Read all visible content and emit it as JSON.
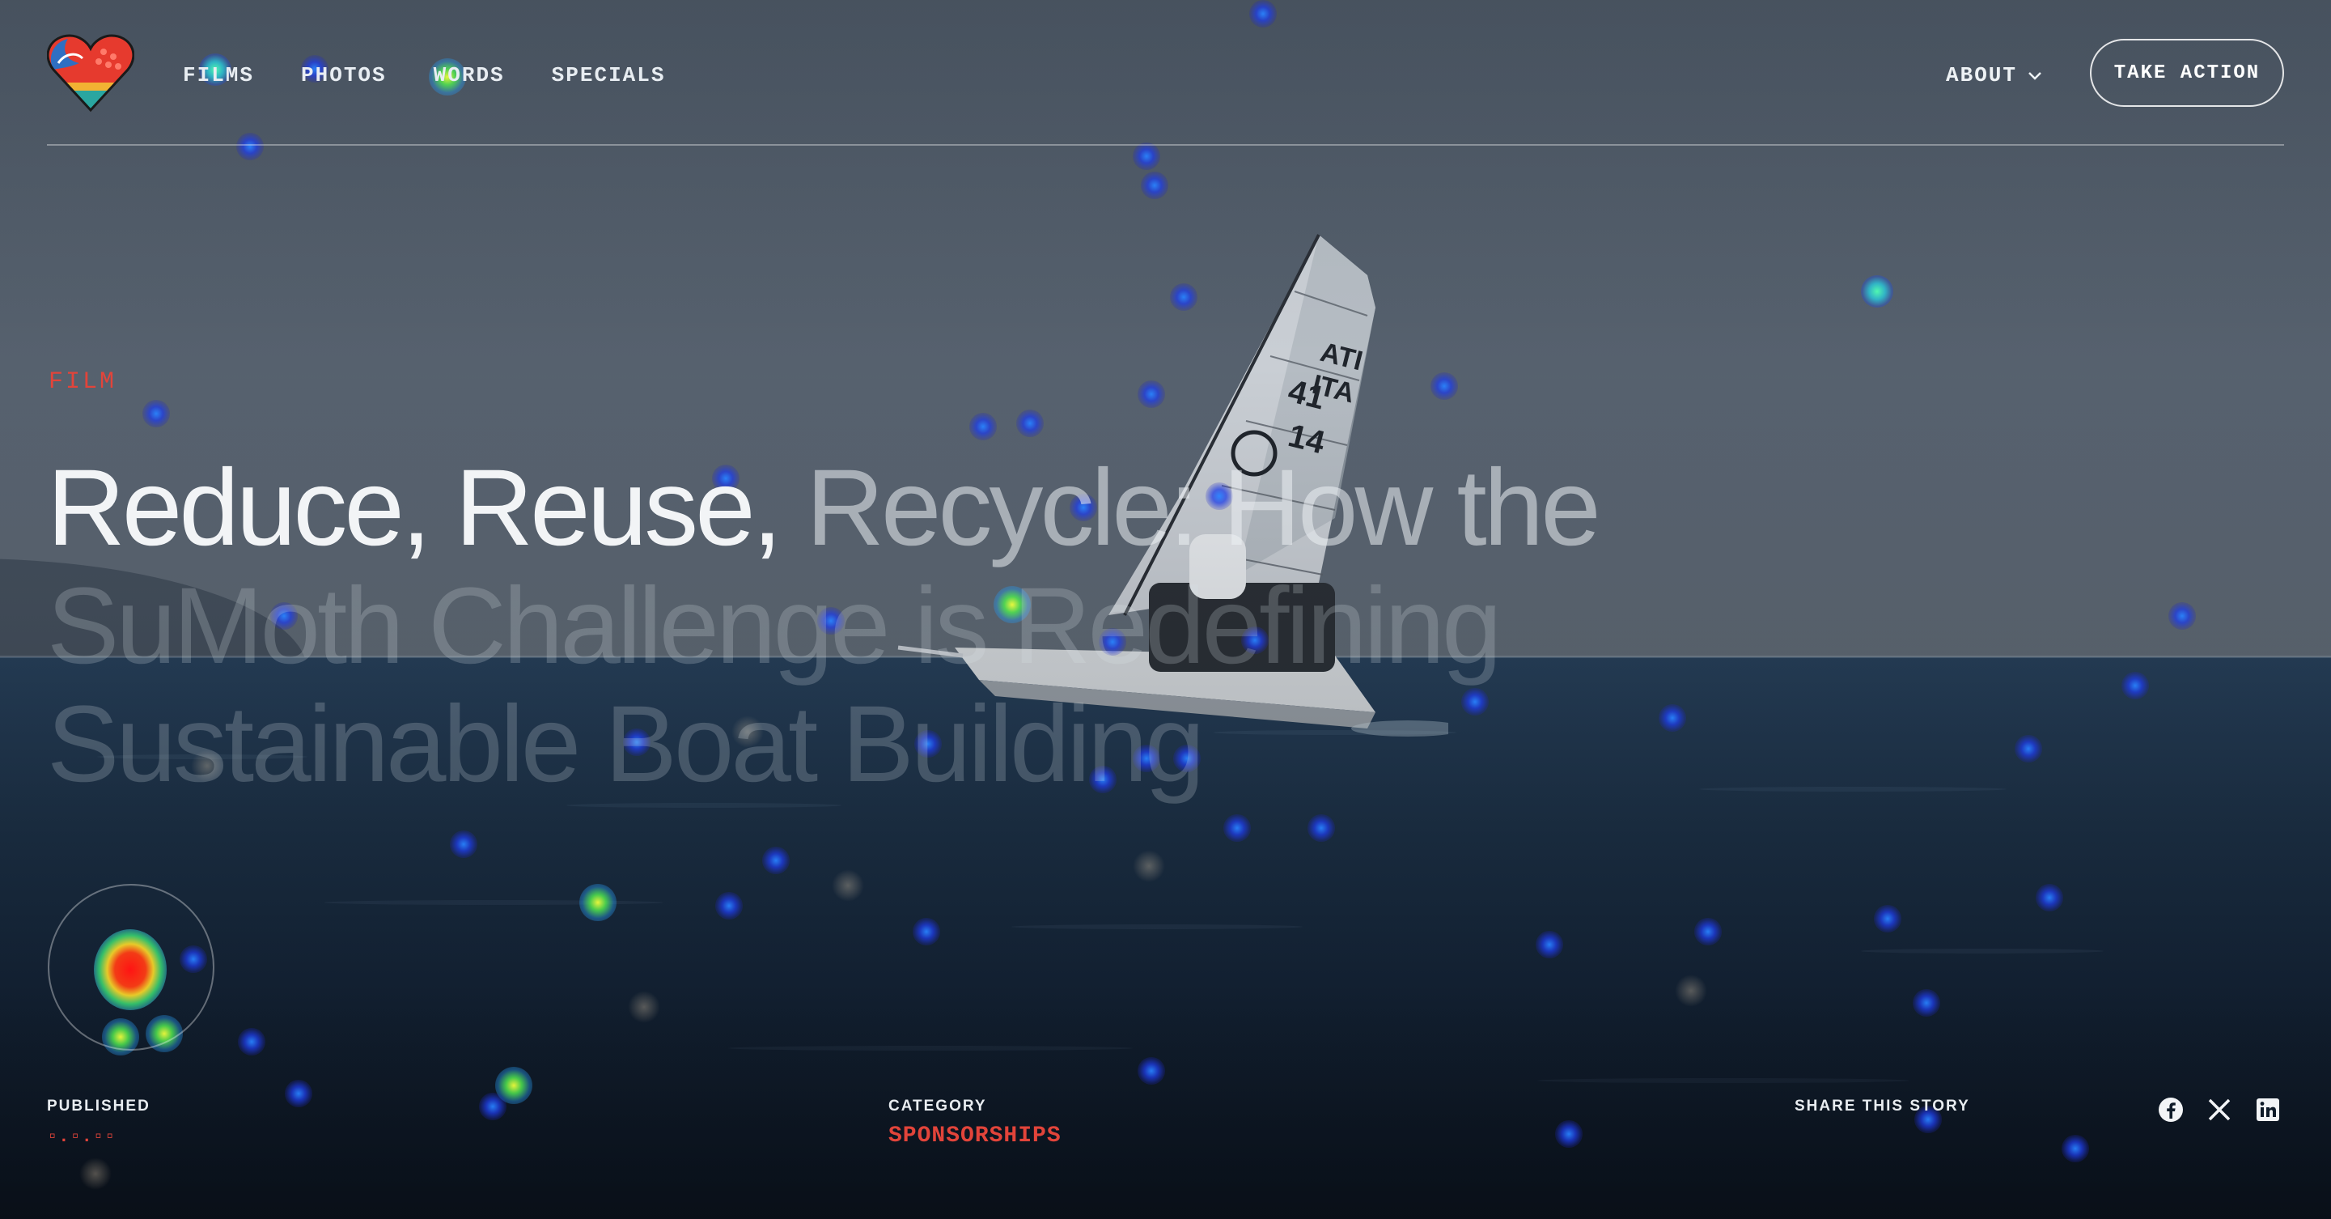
{
  "header": {
    "nav": [
      "FILMS",
      "PHOTOS",
      "WORDS",
      "SPECIALS"
    ],
    "about_label": "ABOUT",
    "cta_label": "TAKE ACTION"
  },
  "hero": {
    "kicker": "FILM",
    "title_part1": "Reduce, Reuse, ",
    "title_part2": "Recycle: How the",
    "title_part3": "SuMoth Challenge is Redefining Sustainable Boat Building"
  },
  "meta": {
    "published_label": "PUBLISHED",
    "published_value": "▫.▫.▫▫",
    "category_label": "CATEGORY",
    "category_value": "SPONSORSHIPS",
    "share_label": "SHARE THIS STORY"
  },
  "icons": {
    "logo": "heart-logo-icon",
    "about_chevron": "chevron-down-icon",
    "facebook": "facebook-icon",
    "x": "x-icon",
    "linkedin": "linkedin-icon"
  },
  "colors": {
    "accent": "#e2443a",
    "text": "#f2f4f6"
  }
}
